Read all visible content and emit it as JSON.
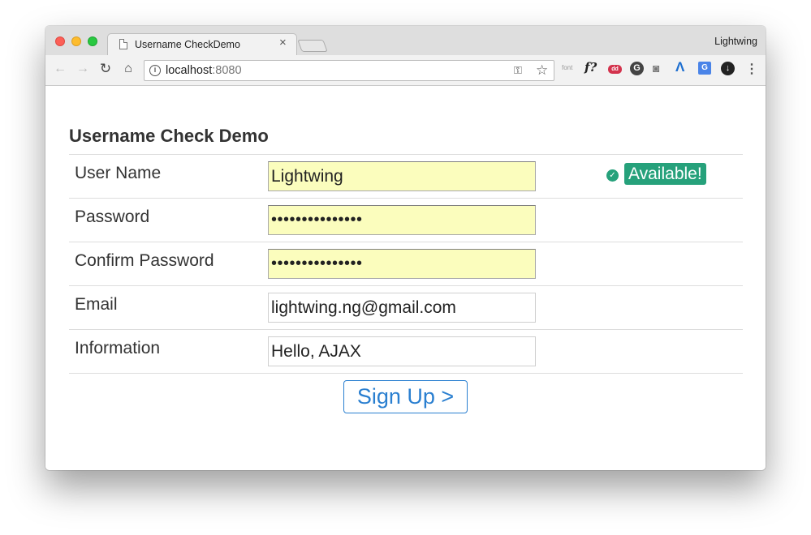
{
  "browser": {
    "tab_title": "Username CheckDemo",
    "profile_name": "Lightwing",
    "url_host": "localhost",
    "url_port": ":8080",
    "ext_font_label": "font",
    "ext_f_label": "f?",
    "ext_dd_label": "dd",
    "ext_g_label": "G",
    "ext_translate_label": "G"
  },
  "page": {
    "title": "Username Check Demo",
    "fields": [
      {
        "label": "User Name",
        "value": "Lightwing"
      },
      {
        "label": "Password",
        "value": "•••••••••••••••"
      },
      {
        "label": "Confirm Password",
        "value": "•••••••••••••••"
      },
      {
        "label": "Email",
        "value": "lightwing.ng@gmail.com"
      },
      {
        "label": "Information",
        "value": "Hello, AJAX"
      }
    ],
    "username_status": "Available!",
    "submit_label": "Sign Up >"
  },
  "colors": {
    "status_green": "#26a17b",
    "button_blue": "#2a7fd0",
    "autofill_yellow": "#fbfdbd"
  },
  "icons": [
    "close-window",
    "minimize-window",
    "maximize-window",
    "page-icon",
    "tab-close-icon",
    "back-arrow-icon",
    "forward-arrow-icon",
    "reload-icon",
    "home-icon",
    "info-icon",
    "key-icon",
    "star-icon",
    "check-circle-icon",
    "menu-icon"
  ]
}
